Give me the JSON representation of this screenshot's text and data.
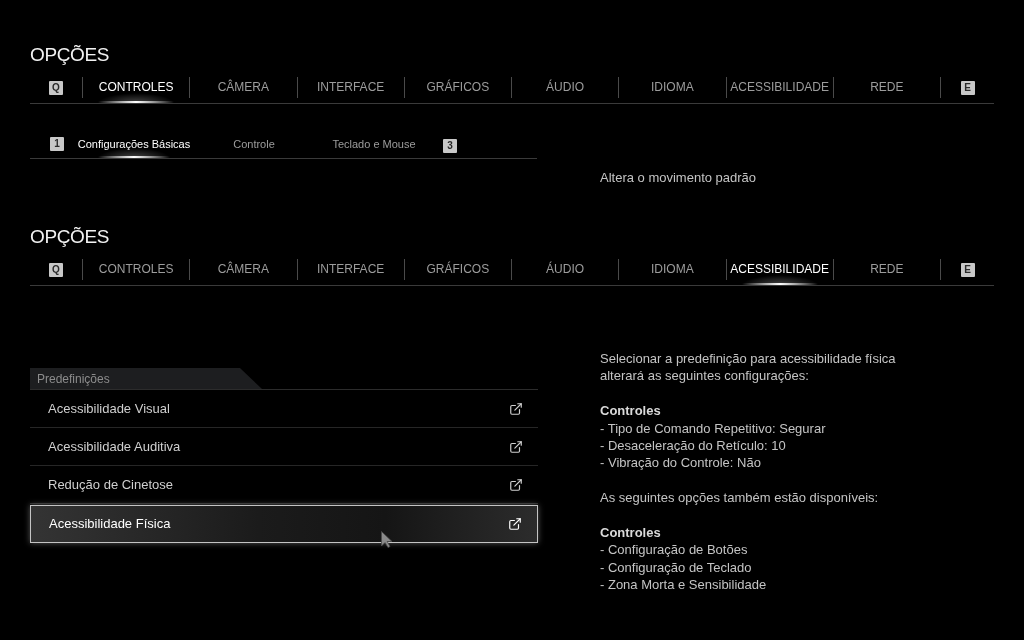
{
  "screens": [
    {
      "kind": "controls",
      "title": "OPÇÕES",
      "prev_key": "Q",
      "next_key": "E",
      "tabs": [
        {
          "label": "CONTROLES",
          "selected": true
        },
        {
          "label": "CÂMERA",
          "selected": false
        },
        {
          "label": "INTERFACE",
          "selected": false
        },
        {
          "label": "GRÁFICOS",
          "selected": false
        },
        {
          "label": "ÁUDIO",
          "selected": false
        },
        {
          "label": "IDIOMA",
          "selected": false
        },
        {
          "label": "ACESSIBILIDADE",
          "selected": false
        },
        {
          "label": "REDE",
          "selected": false
        }
      ],
      "subtabs": {
        "prev_key": "1",
        "next_key": "3",
        "items": [
          {
            "label": "Configurações Básicas",
            "selected": true
          },
          {
            "label": "Controle",
            "selected": false
          },
          {
            "label": "Teclado e Mouse",
            "selected": false
          }
        ]
      },
      "description": "Altera o movimento padrão"
    },
    {
      "kind": "accessibility",
      "title": "OPÇÕES",
      "prev_key": "Q",
      "next_key": "E",
      "tabs": [
        {
          "label": "CONTROLES",
          "selected": false
        },
        {
          "label": "CÂMERA",
          "selected": false
        },
        {
          "label": "INTERFACE",
          "selected": false
        },
        {
          "label": "GRÁFICOS",
          "selected": false
        },
        {
          "label": "ÁUDIO",
          "selected": false
        },
        {
          "label": "IDIOMA",
          "selected": false
        },
        {
          "label": "ACESSIBILIDADE",
          "selected": true
        },
        {
          "label": "REDE",
          "selected": false
        }
      ],
      "presets": {
        "header": "Predefinições",
        "items": [
          {
            "label": "Acessibilidade Visual",
            "selected": false
          },
          {
            "label": "Acessibilidade Auditiva",
            "selected": false
          },
          {
            "label": "Redução de Cinetose",
            "selected": false
          },
          {
            "label": "Acessibilidade Física",
            "selected": true
          }
        ]
      },
      "details": [
        {
          "kind": "paragraph",
          "text": "Selecionar a predefinição para acessibilidade física alterará as seguintes configurações:"
        },
        {
          "kind": "section",
          "heading": "Controles",
          "items": [
            "- Tipo de Comando Repetitivo: Segurar",
            "- Desaceleração do Retículo: 10",
            "- Vibração do Controle: Não"
          ]
        },
        {
          "kind": "paragraph",
          "text": "As seguintes opções também estão disponíveis:"
        },
        {
          "kind": "section",
          "heading": "Controles",
          "items": [
            "- Configuração de Botões",
            "- Configuração de Teclado",
            "- Zona Morta e Sensibilidade"
          ]
        }
      ]
    }
  ]
}
